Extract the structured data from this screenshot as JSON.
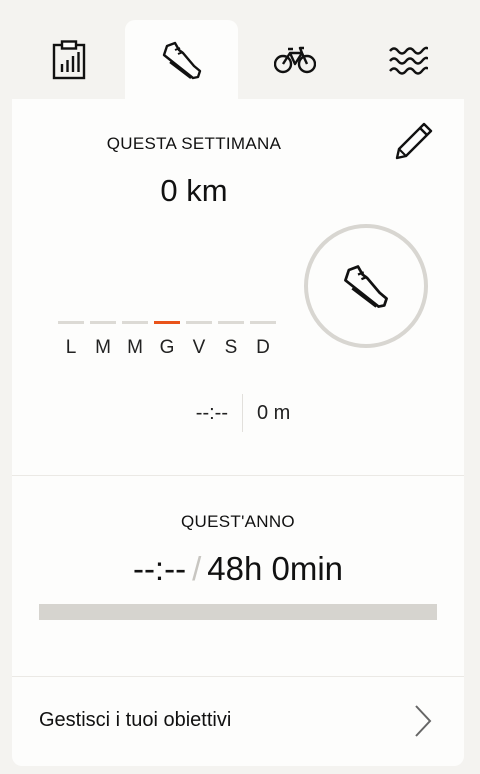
{
  "tabs": [
    {
      "id": "summary",
      "icon": "clipboard-chart-icon",
      "active": false
    },
    {
      "id": "run",
      "icon": "running-shoe-icon",
      "active": true
    },
    {
      "id": "cycle",
      "icon": "bicycle-icon",
      "active": false
    },
    {
      "id": "swim",
      "icon": "waves-icon",
      "active": false
    }
  ],
  "week": {
    "title": "QUESTA SETTIMANA",
    "distance": "0 km",
    "edit_icon": "pencil-icon",
    "ring_icon": "running-shoe-icon",
    "days": [
      "L",
      "M",
      "M",
      "G",
      "V",
      "S",
      "D"
    ],
    "current_day_index": 3,
    "time": "--:--",
    "distance_detail": "0 m"
  },
  "year": {
    "title": "QUEST'ANNO",
    "current": "--:--",
    "separator": "/",
    "goal": "48h 0min",
    "progress_fraction": 0
  },
  "manage": {
    "label": "Gestisci i tuoi obiettivi",
    "icon": "chevron-right-icon"
  },
  "colors": {
    "accent": "#e9531a",
    "background": "#f4f3f0",
    "card": "#fdfdfc",
    "track": "#d6d4cf"
  }
}
